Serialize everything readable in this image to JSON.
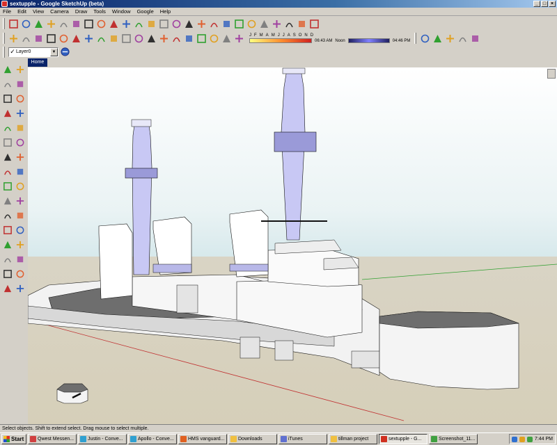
{
  "window": {
    "title": "sextupple - Google SketchUp (beta)",
    "buttons": [
      "_",
      "□",
      "×"
    ]
  },
  "menubar": [
    "File",
    "Edit",
    "View",
    "Camera",
    "Draw",
    "Tools",
    "Window",
    "Google",
    "Help"
  ],
  "toolbar_main": {
    "icons": [
      "select-icon",
      "make-component-icon",
      "eraser-icon",
      "paint-bucket-icon",
      "rectangle-icon",
      "circle-icon",
      "arc-icon",
      "push-pull-icon",
      "move-icon",
      "rotate-icon",
      "follow-me-icon",
      "offset-icon",
      "tape-measure-icon",
      "dimension-icon",
      "protractor-icon",
      "text-icon",
      "axes-icon",
      "orbit-icon",
      "pan-icon",
      "zoom-icon",
      "zoom-window-icon",
      "zoom-extents-icon",
      "google-earth-icon",
      "warehouse-icon",
      "get-models-icon"
    ]
  },
  "toolbar_standard": {
    "icons": [
      "new-icon",
      "open-icon",
      "save-icon",
      "cut-icon",
      "copy-icon",
      "paste-icon",
      "erase-icon",
      "undo-icon",
      "redo-icon",
      "print-icon",
      "model-info-icon",
      "iso-view-icon",
      "top-view-icon",
      "front-view-icon",
      "right-view-icon",
      "back-view-icon",
      "left-view-icon",
      "section-plane-icon",
      "section-display-icon"
    ]
  },
  "shadow_settings": {
    "months": [
      "J",
      "F",
      "M",
      "A",
      "M",
      "J",
      "J",
      "A",
      "S",
      "O",
      "N",
      "D"
    ],
    "start_time": "06:43 AM",
    "noon_label": "Noon",
    "end_time": "04:46 PM"
  },
  "toolbar_styles": {
    "icons": [
      "x-ray-icon",
      "wireframe-icon",
      "hidden-line-icon",
      "shaded-icon",
      "shaded-texture-icon"
    ]
  },
  "layer_toolbar": {
    "current_layer": "Layer0",
    "check": "✓"
  },
  "scene_tab": "Home",
  "left_toolbar": {
    "icons": [
      "select-icon",
      "make-component-icon",
      "paint-bucket-icon",
      "eraser-icon",
      "rectangle-icon",
      "line-icon",
      "circle-icon",
      "arc-icon",
      "polygon-icon",
      "freehand-icon",
      "move-icon",
      "push-pull-icon",
      "rotate-icon",
      "follow-me-icon",
      "scale-icon",
      "offset-icon",
      "tape-measure-icon",
      "dimension-icon",
      "protractor-icon",
      "text-icon",
      "axes-icon",
      "3d-text-icon",
      "orbit-icon",
      "pan-icon",
      "zoom-icon",
      "zoom-window-icon",
      "zoom-extents-icon",
      "previous-view-icon",
      "position-camera-icon",
      "walk-icon",
      "look-around-icon",
      "section-plane-icon"
    ]
  },
  "statusbar": {
    "text": "Select objects. Shift to extend select. Drag mouse to select multiple."
  },
  "taskbar": {
    "start": "Start",
    "tasks": [
      {
        "label": "Qwest Messen...",
        "color": "#d04040"
      },
      {
        "label": "Justin - Conve...",
        "color": "#30a0d0"
      },
      {
        "label": "Apollo - Conve...",
        "color": "#30a0d0"
      },
      {
        "label": "HMS vanguard...",
        "color": "#e06020"
      },
      {
        "label": "Downloads",
        "color": "#f0c040"
      },
      {
        "label": "iTunes",
        "color": "#6070d0"
      },
      {
        "label": "tillman project",
        "color": "#f0c040"
      },
      {
        "label": "sextupple - G...",
        "color": "#d03020"
      },
      {
        "label": "Screenshot_11...",
        "color": "#40a040"
      }
    ],
    "clock": "7:44 PM"
  }
}
